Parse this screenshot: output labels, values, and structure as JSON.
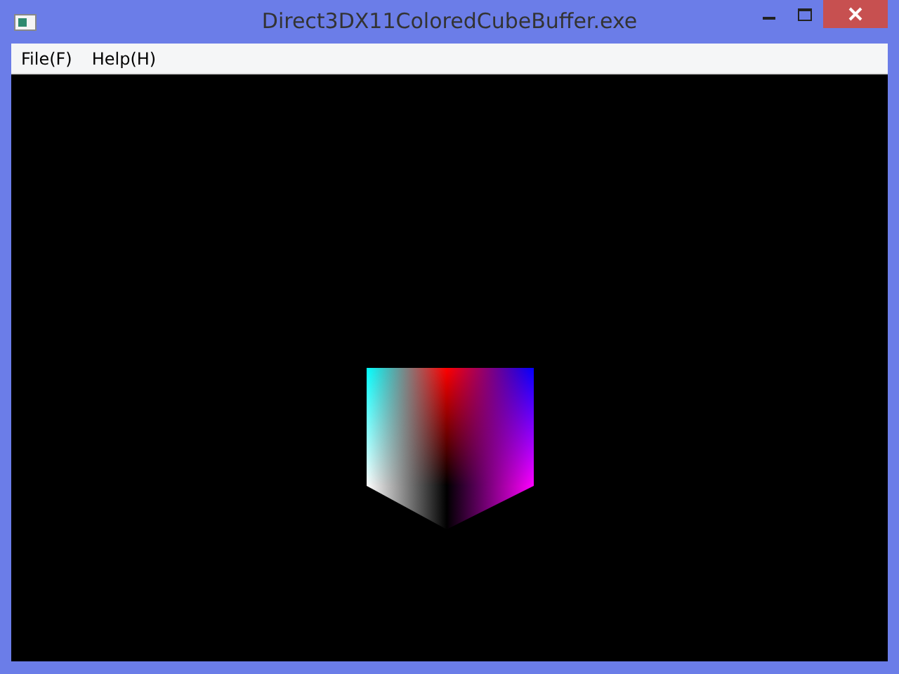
{
  "window": {
    "title": "Direct3DX11ColoredCubeBuffer.exe"
  },
  "menu": [
    {
      "label": "File(F)"
    },
    {
      "label": "Help(H)"
    }
  ]
}
